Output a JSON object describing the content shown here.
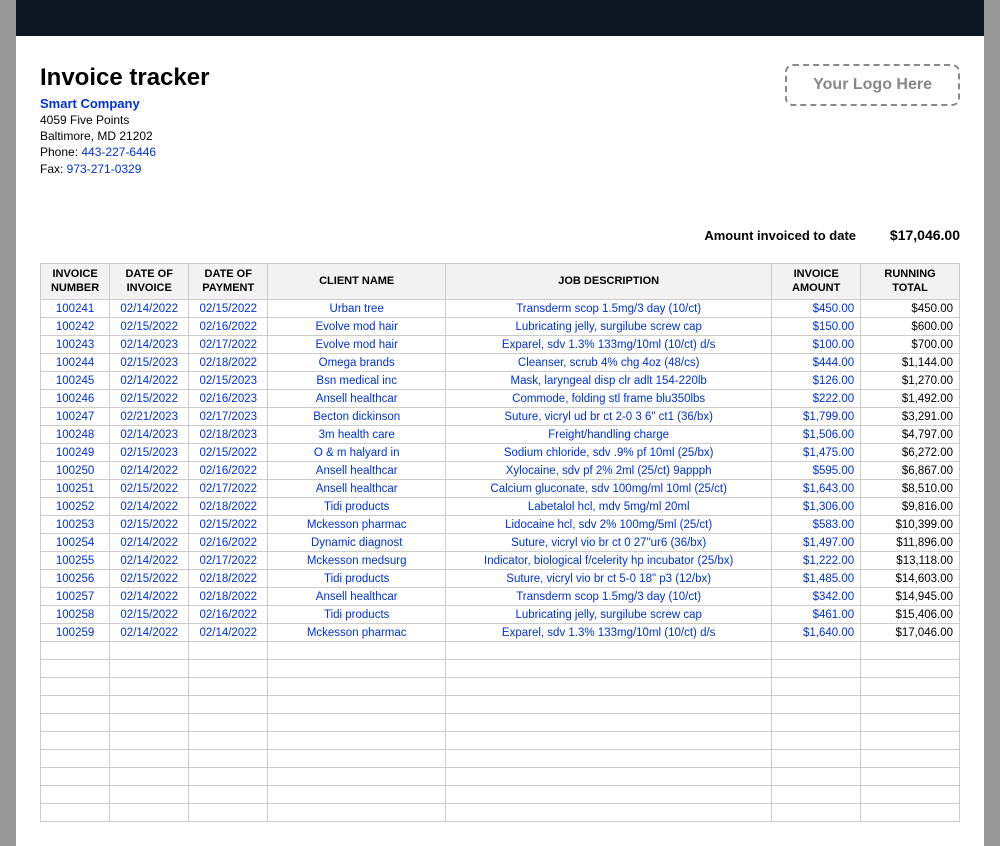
{
  "header": {
    "title": "Invoice tracker",
    "company": "Smart Company",
    "address1": "4059 Five Points",
    "address2": "Baltimore, MD 21202",
    "phone_label": "Phone: ",
    "phone": "443-227-6446",
    "fax_label": "Fax: ",
    "fax": "973-271-0329",
    "logo_placeholder": "Your Logo Here"
  },
  "summary": {
    "label": "Amount invoiced to date",
    "value": "$17,046.00"
  },
  "columns": {
    "invoice_number": "INVOICE NUMBER",
    "date_invoice": "DATE OF INVOICE",
    "date_payment": "DATE OF PAYMENT",
    "client": "CLIENT NAME",
    "desc": "JOB DESCRIPTION",
    "amount": "INVOICE AMOUNT",
    "running": "RUNNING TOTAL"
  },
  "rows": [
    {
      "num": "100241",
      "di": "02/14/2022",
      "dp": "02/15/2022",
      "client": "Urban tree",
      "desc": "Transderm scop 1.5mg/3 day (10/ct)",
      "amt": "$450.00",
      "run": "$450.00"
    },
    {
      "num": "100242",
      "di": "02/15/2022",
      "dp": "02/16/2022",
      "client": "Evolve mod hair",
      "desc": "Lubricating jelly, surgilube screw cap",
      "amt": "$150.00",
      "run": "$600.00"
    },
    {
      "num": "100243",
      "di": "02/14/2023",
      "dp": "02/17/2022",
      "client": "Evolve mod hair",
      "desc": "Exparel, sdv 1.3% 133mg/10ml (10/ct) d/s",
      "amt": "$100.00",
      "run": "$700.00"
    },
    {
      "num": "100244",
      "di": "02/15/2023",
      "dp": "02/18/2022",
      "client": "Omega brands",
      "desc": "Cleanser, scrub 4% chg 4oz (48/cs)",
      "amt": "$444.00",
      "run": "$1,144.00"
    },
    {
      "num": "100245",
      "di": "02/14/2022",
      "dp": "02/15/2023",
      "client": "Bsn medical inc",
      "desc": "Mask, laryngeal disp clr adlt 154-220lb",
      "amt": "$126.00",
      "run": "$1,270.00"
    },
    {
      "num": "100246",
      "di": "02/15/2022",
      "dp": "02/16/2023",
      "client": "Ansell healthcar",
      "desc": "Commode, folding stl frame blu350lbs",
      "amt": "$222.00",
      "run": "$1,492.00"
    },
    {
      "num": "100247",
      "di": "02/21/2023",
      "dp": "02/17/2023",
      "client": "Becton dickinson",
      "desc": "Suture, vicryl ud br ct 2-0 3 6\" ct1 (36/bx)",
      "amt": "$1,799.00",
      "run": "$3,291.00"
    },
    {
      "num": "100248",
      "di": "02/14/2023",
      "dp": "02/18/2023",
      "client": "3m health care",
      "desc": "Freight/handling charge",
      "amt": "$1,506.00",
      "run": "$4,797.00"
    },
    {
      "num": "100249",
      "di": "02/15/2023",
      "dp": "02/15/2022",
      "client": "O & m halyard in",
      "desc": "Sodium chloride, sdv .9% pf 10ml (25/bx)",
      "amt": "$1,475.00",
      "run": "$6,272.00"
    },
    {
      "num": "100250",
      "di": "02/14/2022",
      "dp": "02/16/2022",
      "client": "Ansell healthcar",
      "desc": "Xylocaine, sdv pf 2% 2ml (25/ct) 9appph",
      "amt": "$595.00",
      "run": "$6,867.00"
    },
    {
      "num": "100251",
      "di": "02/15/2022",
      "dp": "02/17/2022",
      "client": "Ansell healthcar",
      "desc": "Calcium gluconate, sdv 100mg/ml 10ml (25/ct)",
      "amt": "$1,643.00",
      "run": "$8,510.00"
    },
    {
      "num": "100252",
      "di": "02/14/2022",
      "dp": "02/18/2022",
      "client": "Tidi products",
      "desc": "Labetalol hcl, mdv 5mg/ml 20ml",
      "amt": "$1,306.00",
      "run": "$9,816.00"
    },
    {
      "num": "100253",
      "di": "02/15/2022",
      "dp": "02/15/2022",
      "client": "Mckesson pharmac",
      "desc": "Lidocaine hcl, sdv 2% 100mg/5ml (25/ct)",
      "amt": "$583.00",
      "run": "$10,399.00"
    },
    {
      "num": "100254",
      "di": "02/14/2022",
      "dp": "02/16/2022",
      "client": "Dynamic diagnost",
      "desc": "Suture, vicryl vio br ct 0 27\"ur6 (36/bx)",
      "amt": "$1,497.00",
      "run": "$11,896.00"
    },
    {
      "num": "100255",
      "di": "02/14/2022",
      "dp": "02/17/2022",
      "client": "Mckesson medsurg",
      "desc": "Indicator, biological f/celerity hp incubator (25/bx)",
      "amt": "$1,222.00",
      "run": "$13,118.00"
    },
    {
      "num": "100256",
      "di": "02/15/2022",
      "dp": "02/18/2022",
      "client": "Tidi products",
      "desc": "Suture, vicryl vio br ct 5-0 18\" p3 (12/bx)",
      "amt": "$1,485.00",
      "run": "$14,603.00"
    },
    {
      "num": "100257",
      "di": "02/14/2022",
      "dp": "02/18/2022",
      "client": "Ansell healthcar",
      "desc": "Transderm scop 1.5mg/3 day (10/ct)",
      "amt": "$342.00",
      "run": "$14,945.00"
    },
    {
      "num": "100258",
      "di": "02/15/2022",
      "dp": "02/16/2022",
      "client": "Tidi products",
      "desc": "Lubricating jelly, surgilube screw cap",
      "amt": "$461.00",
      "run": "$15,406.00"
    },
    {
      "num": "100259",
      "di": "02/14/2022",
      "dp": "02/14/2022",
      "client": "Mckesson pharmac",
      "desc": "Exparel, sdv 1.3% 133mg/10ml (10/ct) d/s",
      "amt": "$1,640.00",
      "run": "$17,046.00"
    }
  ],
  "emptyRows": 10
}
